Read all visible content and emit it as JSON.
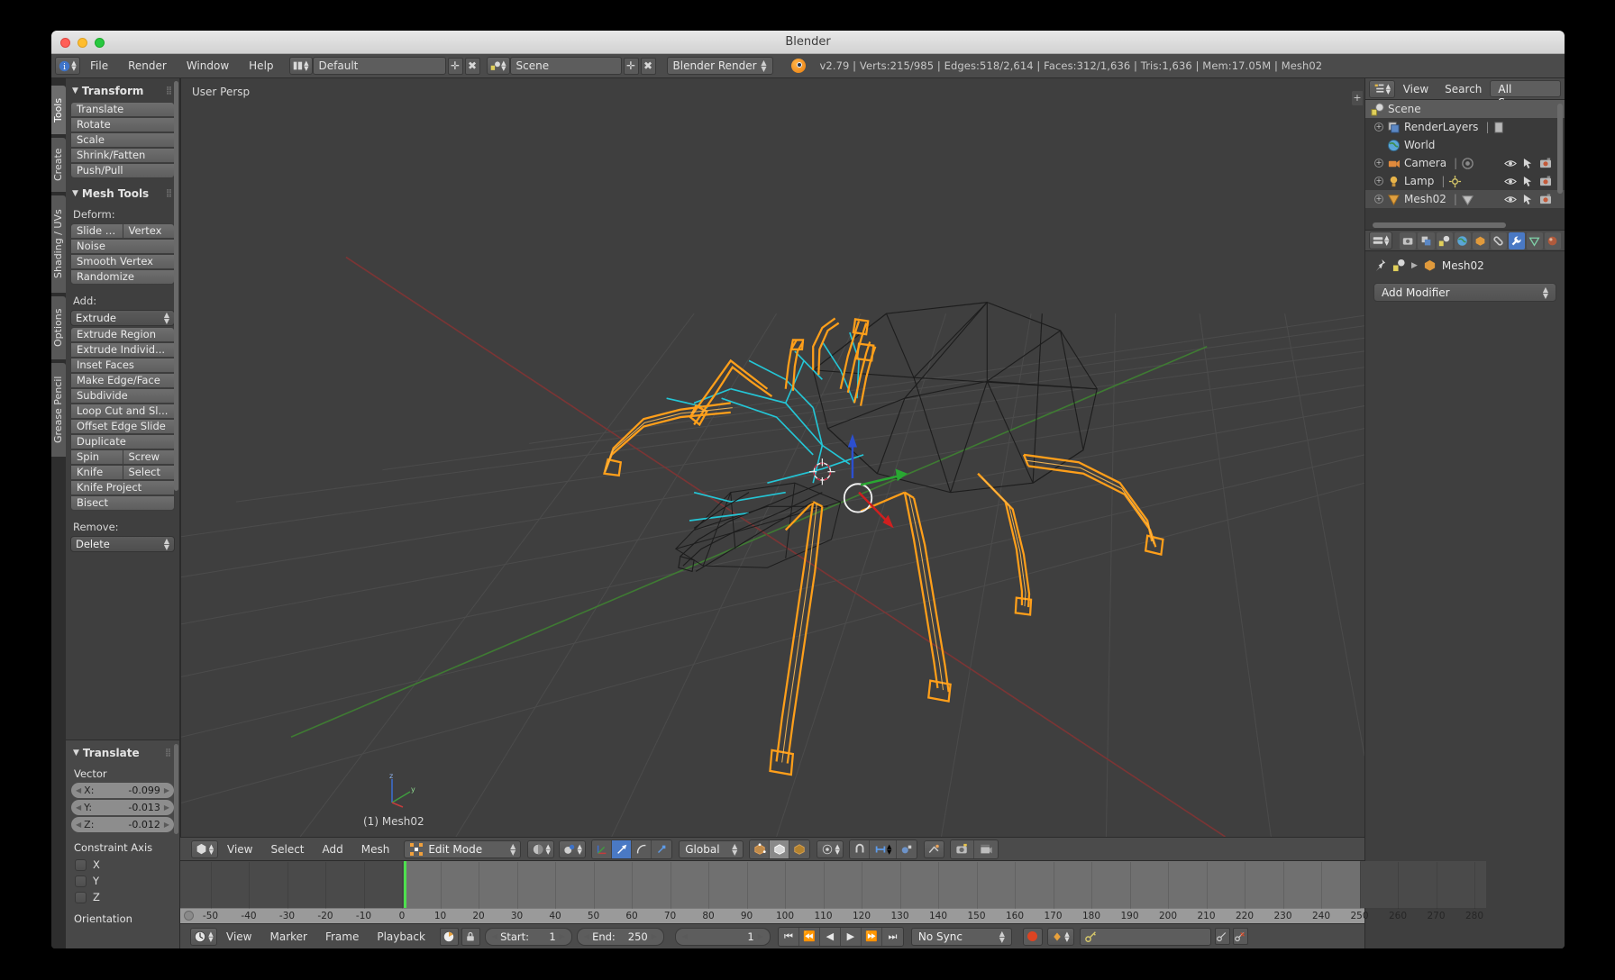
{
  "window": {
    "title": "Blender"
  },
  "topbar": {
    "menus": [
      "File",
      "Render",
      "Window",
      "Help"
    ],
    "screen_layout": "Default",
    "scene_name": "Scene",
    "engine": "Blender Render",
    "stats": "v2.79 | Verts:215/985 | Edges:518/2,614 | Faces:312/1,636 | Tris:1,636 | Mem:17.05M | Mesh02",
    "add_icon": "plus-icon",
    "remove_icon": "x-icon"
  },
  "tool_tabs": [
    {
      "label": "Tools",
      "active": true
    },
    {
      "label": "Create",
      "active": false
    },
    {
      "label": "Shading / UVs",
      "active": false
    },
    {
      "label": "Options",
      "active": false
    },
    {
      "label": "Grease Pencil",
      "active": false
    }
  ],
  "tool_panel": {
    "transform": {
      "title": "Transform",
      "buttons": [
        "Translate",
        "Rotate",
        "Scale",
        "Shrink/Fatten",
        "Push/Pull"
      ]
    },
    "mesh_tools": {
      "title": "Mesh Tools",
      "deform_label": "Deform:",
      "deform_row": [
        "Slide Ed",
        "Vertex"
      ],
      "deform_buttons": [
        "Noise",
        "Smooth Vertex",
        "Randomize"
      ],
      "add_label": "Add:",
      "add_dropdown": "Extrude",
      "add_buttons": [
        "Extrude Region",
        "Extrude Individ...",
        "Inset Faces",
        "Make Edge/Face",
        "Subdivide",
        "Loop Cut and Sl...",
        "Offset Edge Slide",
        "Duplicate"
      ],
      "add_row1": [
        "Spin",
        "Screw"
      ],
      "add_row2": [
        "Knife",
        "Select"
      ],
      "add_buttons2": [
        "Knife Project",
        "Bisect"
      ],
      "remove_label": "Remove:",
      "remove_dropdown": "Delete"
    }
  },
  "operator_panel": {
    "title": "Translate",
    "vector_label": "Vector",
    "fields": [
      {
        "label": "X:",
        "value": "-0.099"
      },
      {
        "label": "Y:",
        "value": "-0.013"
      },
      {
        "label": "Z:",
        "value": "-0.012"
      }
    ],
    "constraint_axis_label": "Constraint Axis",
    "axes": [
      {
        "label": "X",
        "checked": false
      },
      {
        "label": "Y",
        "checked": false
      },
      {
        "label": "Z",
        "checked": false
      }
    ],
    "orientation_label": "Orientation"
  },
  "viewport": {
    "view_label": "User Persp",
    "object_label": "(1) Mesh02",
    "axis_gizmo": {
      "z": "z",
      "y": "y",
      "x": "x"
    }
  },
  "viewport_header": {
    "menus": [
      "View",
      "Select",
      "Add",
      "Mesh"
    ],
    "mode": "Edit Mode",
    "orientation": "Global",
    "icons": [
      "editor-type-icon",
      "viewport-shading-icon",
      "pivot-point-icon",
      "manipulator-icon",
      "translate-manipulator-icon",
      "rotate-manipulator-icon",
      "scale-manipulator-icon",
      "vertex-select-icon",
      "edge-select-icon",
      "face-select-icon",
      "limit-selection-icon",
      "snap-magnet-icon",
      "snap-target-icon",
      "proportional-edit-icon",
      "mesh-display-icon",
      "render-preview-icon",
      "viewport-render-icon"
    ]
  },
  "timeline": {
    "menus": [
      "View",
      "Marker",
      "Frame",
      "Playback"
    ],
    "start": {
      "label": "Start:",
      "value": "1"
    },
    "end": {
      "label": "End:",
      "value": "250"
    },
    "current_frame": "1",
    "sync_mode": "No Sync",
    "transport_icons": [
      "jump-to-start-icon",
      "prev-keyframe-icon",
      "play-reverse-icon",
      "play-icon",
      "next-keyframe-icon",
      "jump-to-end-icon"
    ],
    "record_icon": "record-icon",
    "keyingset_icon": "keyingset-icon",
    "auto_key_icon": "keyframe-icon",
    "ruler_ticks": [
      "-50",
      "-40",
      "-30",
      "-20",
      "-10",
      "0",
      "10",
      "20",
      "30",
      "40",
      "50",
      "60",
      "70",
      "80",
      "90",
      "100",
      "110",
      "120",
      "130",
      "140",
      "150",
      "160",
      "170",
      "180",
      "190",
      "200",
      "210",
      "220",
      "230",
      "240",
      "250",
      "260",
      "270",
      "280"
    ],
    "playhead_frame": "0"
  },
  "outliner": {
    "menus": [
      "View",
      "Search"
    ],
    "filter_button": "All Scenes",
    "display_mode_icon": "outliner-display-icon",
    "rows": [
      {
        "label": "Scene",
        "icon": "scene-icon",
        "indent": 0,
        "expand": false,
        "actions": false,
        "highlight": "current"
      },
      {
        "label": "RenderLayers",
        "icon": "renderlayers-icon",
        "indent": 1,
        "expand": true,
        "actions": false,
        "highlight": ""
      },
      {
        "label": "World",
        "icon": "world-icon",
        "indent": 1,
        "expand": false,
        "actions": false,
        "highlight": ""
      },
      {
        "label": "Camera",
        "icon": "camera-icon",
        "indent": 1,
        "expand": true,
        "actions": true,
        "highlight": ""
      },
      {
        "label": "Lamp",
        "icon": "lamp-icon",
        "indent": 1,
        "expand": true,
        "actions": true,
        "highlight": ""
      },
      {
        "label": "Mesh02",
        "icon": "mesh-icon",
        "indent": 1,
        "expand": true,
        "actions": true,
        "highlight": "sel"
      }
    ]
  },
  "properties": {
    "tabs": [
      "render-tab",
      "render-layers-tab",
      "scene-tab",
      "world-tab",
      "object-tab",
      "constraints-tab",
      "modifiers-tab",
      "data-tab",
      "material-tab"
    ],
    "active_tab_index": 6,
    "breadcrumb_object": "Mesh02",
    "pin_icon": "pin-icon",
    "add_modifier_label": "Add Modifier"
  }
}
